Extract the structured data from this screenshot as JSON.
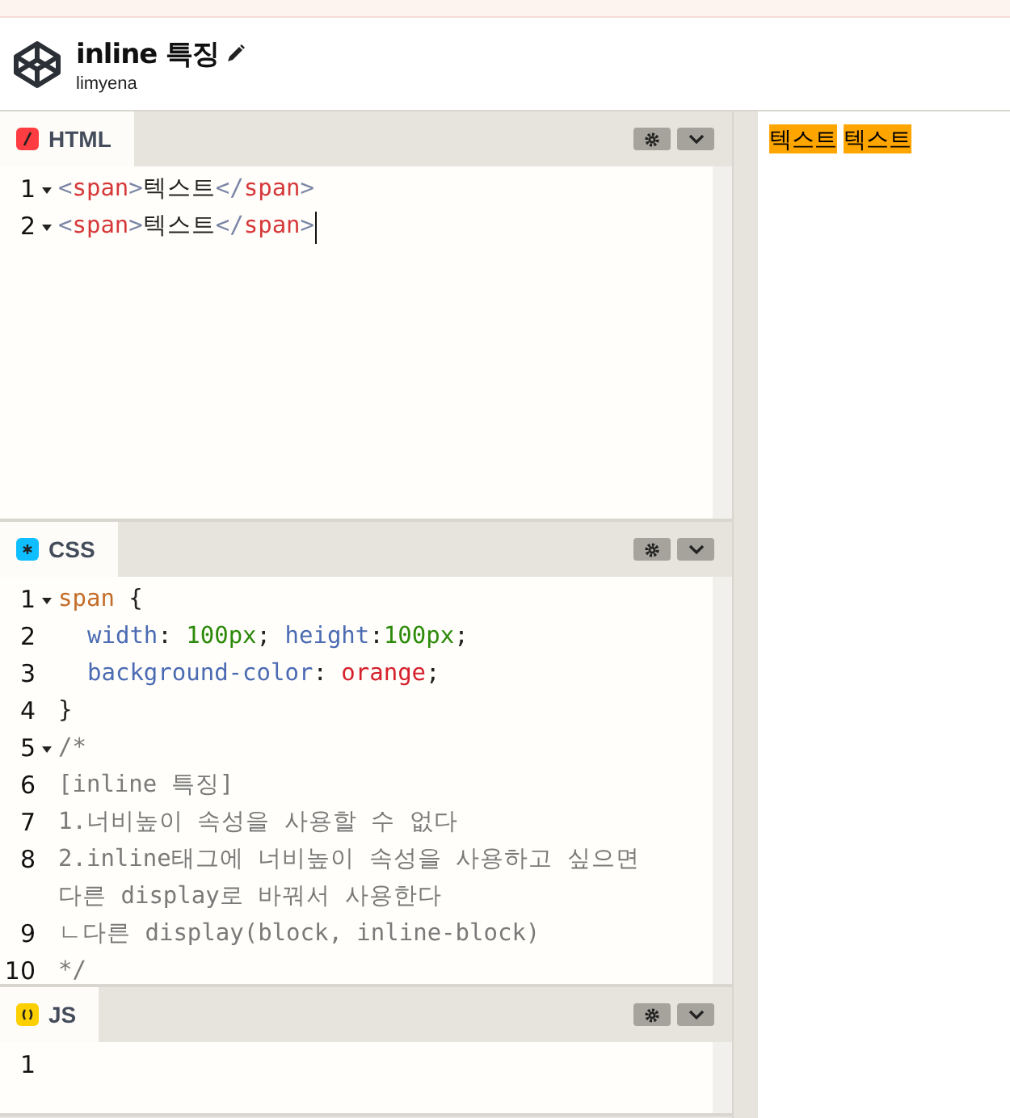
{
  "header": {
    "title": "inline 특징",
    "author": "limyena"
  },
  "editors": [
    {
      "kind": "html",
      "label": "HTML",
      "lines": [
        {
          "number": "1",
          "fold": true,
          "cursor": false,
          "tokens": [
            {
              "kind": "bracket",
              "text": "<"
            },
            {
              "kind": "tag",
              "text": "span"
            },
            {
              "kind": "bracket",
              "text": ">"
            },
            {
              "kind": "plain",
              "text": "텍스트"
            },
            {
              "kind": "bracket",
              "text": "</"
            },
            {
              "kind": "tag",
              "text": "span"
            },
            {
              "kind": "bracket",
              "text": ">"
            }
          ]
        },
        {
          "number": "2",
          "fold": true,
          "cursor": true,
          "tokens": [
            {
              "kind": "bracket",
              "text": "<"
            },
            {
              "kind": "tag",
              "text": "span"
            },
            {
              "kind": "bracket",
              "text": ">"
            },
            {
              "kind": "plain",
              "text": "텍스트"
            },
            {
              "kind": "bracket",
              "text": "</"
            },
            {
              "kind": "tag",
              "text": "span"
            },
            {
              "kind": "bracket",
              "text": ">"
            }
          ]
        }
      ]
    },
    {
      "kind": "css",
      "label": "CSS",
      "lines": [
        {
          "number": "1",
          "fold": true,
          "cursor": false,
          "tokens": [
            {
              "kind": "selector",
              "text": "span"
            },
            {
              "kind": "plain",
              "text": " {"
            }
          ]
        },
        {
          "number": "2",
          "fold": false,
          "cursor": false,
          "indent": true,
          "tokens": [
            {
              "kind": "property",
              "text": "width"
            },
            {
              "kind": "plain",
              "text": ": "
            },
            {
              "kind": "number",
              "text": "100"
            },
            {
              "kind": "unit",
              "text": "px"
            },
            {
              "kind": "plain",
              "text": "; "
            },
            {
              "kind": "property",
              "text": "height"
            },
            {
              "kind": "plain",
              "text": ":"
            },
            {
              "kind": "number",
              "text": "100"
            },
            {
              "kind": "unit",
              "text": "px"
            },
            {
              "kind": "plain",
              "text": ";"
            }
          ]
        },
        {
          "number": "3",
          "fold": false,
          "cursor": false,
          "indent": true,
          "tokens": [
            {
              "kind": "property",
              "text": "background-color"
            },
            {
              "kind": "plain",
              "text": ": "
            },
            {
              "kind": "value",
              "text": "orange"
            },
            {
              "kind": "plain",
              "text": ";"
            }
          ]
        },
        {
          "number": "4",
          "fold": false,
          "cursor": false,
          "tokens": [
            {
              "kind": "plain",
              "text": "}"
            }
          ]
        },
        {
          "number": "5",
          "fold": true,
          "cursor": false,
          "tokens": [
            {
              "kind": "comment",
              "text": "/*"
            }
          ]
        },
        {
          "number": "6",
          "fold": false,
          "cursor": false,
          "tokens": [
            {
              "kind": "comment",
              "text": "[inline 특징]"
            }
          ]
        },
        {
          "number": "7",
          "fold": false,
          "cursor": false,
          "tokens": [
            {
              "kind": "comment",
              "text": "1.너비높이 속성을 사용할 수 없다"
            }
          ]
        },
        {
          "number": "8",
          "fold": false,
          "cursor": false,
          "tokens": [
            {
              "kind": "comment",
              "text": "2.inline태그에 너비높이 속성을 사용하고 싶으면 다른 display로 바꿔서 사용한다"
            }
          ]
        },
        {
          "number": "9",
          "fold": false,
          "cursor": false,
          "tokens": [
            {
              "kind": "comment",
              "text": "ㄴ다른 display(block, inline-block)"
            }
          ]
        },
        {
          "number": "10",
          "fold": false,
          "cursor": false,
          "tokens": [
            {
              "kind": "comment",
              "text": "*/"
            }
          ]
        }
      ]
    },
    {
      "kind": "js",
      "label": "JS",
      "lines": [
        {
          "number": "1",
          "fold": false,
          "cursor": false
        }
      ]
    }
  ],
  "preview": {
    "spans": [
      "텍스트",
      "텍스트"
    ]
  }
}
